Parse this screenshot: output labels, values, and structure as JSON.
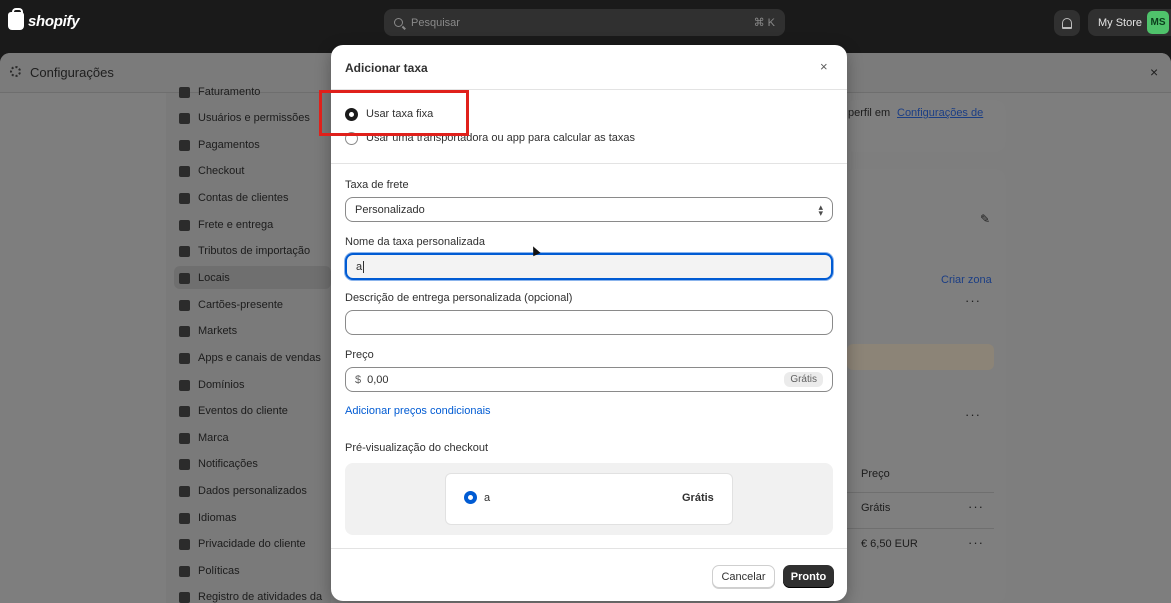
{
  "topbar": {
    "logo_text": "shopify",
    "search_placeholder": "Pesquisar",
    "search_shortcut": "⌘ K",
    "store_name": "My Store",
    "avatar_initials": "MS"
  },
  "settings": {
    "title": "Configurações",
    "close": "×"
  },
  "sidebar": {
    "items": [
      {
        "label": "Faturamento",
        "icon": "billing-icon"
      },
      {
        "label": "Usuários e permissões",
        "icon": "users-icon"
      },
      {
        "label": "Pagamentos",
        "icon": "payments-icon"
      },
      {
        "label": "Checkout",
        "icon": "cart-icon"
      },
      {
        "label": "Contas de clientes",
        "icon": "person-icon"
      },
      {
        "label": "Frete e entrega",
        "icon": "truck-icon"
      },
      {
        "label": "Tributos de importação",
        "icon": "duties-icon"
      },
      {
        "label": "Locais",
        "icon": "location-icon"
      },
      {
        "label": "Cartões-presente",
        "icon": "gift-card-icon"
      },
      {
        "label": "Markets",
        "icon": "globe-icon"
      },
      {
        "label": "Apps e canais de vendas",
        "icon": "apps-icon"
      },
      {
        "label": "Domínios",
        "icon": "domain-icon"
      },
      {
        "label": "Eventos do cliente",
        "icon": "events-icon"
      },
      {
        "label": "Marca",
        "icon": "brand-icon"
      },
      {
        "label": "Notificações",
        "icon": "notification-icon"
      },
      {
        "label": "Dados personalizados",
        "icon": "data-icon"
      },
      {
        "label": "Idiomas",
        "icon": "language-icon"
      },
      {
        "label": "Privacidade do cliente",
        "icon": "lock-icon"
      },
      {
        "label": "Políticas",
        "icon": "policy-icon"
      },
      {
        "label": "Registro de atividades da",
        "icon": "log-icon"
      }
    ],
    "active_index": 5
  },
  "background": {
    "profile_text": "perfil em ",
    "profile_link": "Configurações de",
    "create_zone": "Criar zona",
    "price_header": "Preço",
    "row1_price": "Grátis",
    "row2_price": "€ 6,50 EUR",
    "more": "···"
  },
  "modal": {
    "title": "Adicionar taxa",
    "close": "×",
    "option_fixed": "Usar taxa fixa",
    "option_carrier": "Usar uma transportadora ou app para calcular as taxas",
    "rate_type_label": "Taxa de frete",
    "rate_type_value": "Personalizado",
    "rate_name_label": "Nome da taxa personalizada",
    "rate_name_value": "a",
    "description_label": "Descrição de entrega personalizada (opcional)",
    "description_value": "",
    "price_label": "Preço",
    "currency_symbol": "$",
    "price_value": "0,00",
    "price_badge": "Grátis",
    "conditional_link": "Adicionar preços condicionais",
    "preview_label": "Pré-visualização do checkout",
    "preview_name": "a",
    "preview_price": "Grátis",
    "cancel": "Cancelar",
    "done": "Pronto"
  },
  "colors": {
    "accent": "#005bd3",
    "highlight": "#e0201b",
    "primary_button": "#303030"
  }
}
